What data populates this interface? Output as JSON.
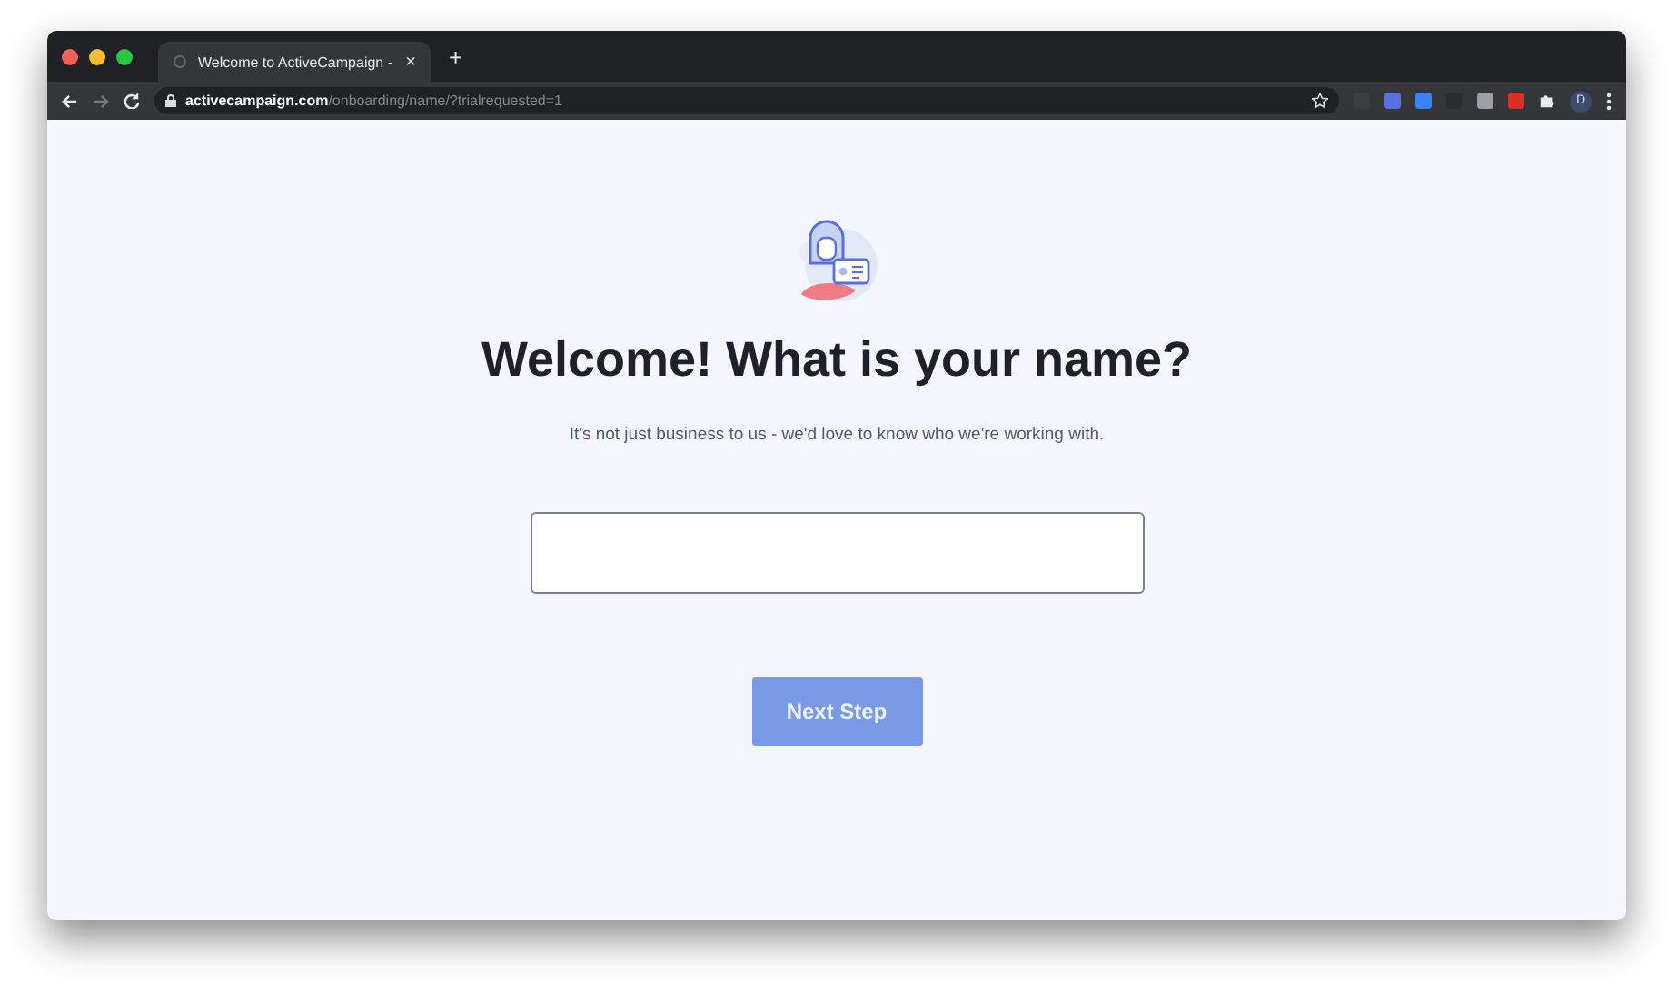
{
  "browser": {
    "tab_title": "Welcome to ActiveCampaign -",
    "tab_close": "×",
    "new_tab": "+",
    "url_host": "activecampaign.com",
    "url_path": "/onboarding/name/?trialrequested=1",
    "profile_initial": "D"
  },
  "page": {
    "heading": "Welcome! What is your name?",
    "subtitle": "It's not just business to us - we'd love to know who we're working with.",
    "next_button": {
      "label": "Next Step",
      "disabled": true
    }
  }
}
